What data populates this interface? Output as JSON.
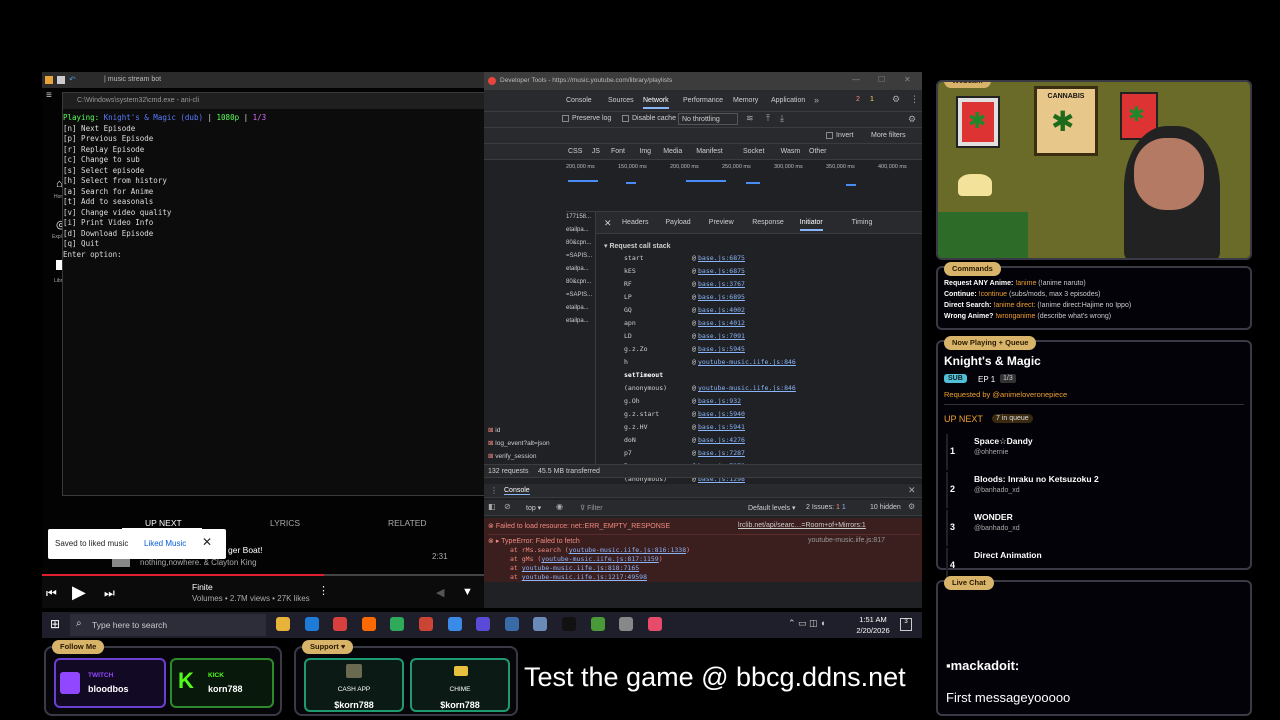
{
  "music": {
    "titlebar": "| music stream bot",
    "cmd": {
      "title": "C:\\Windows\\system32\\cmd.exe - ani-cli",
      "playing_prefix": "Playing: ",
      "playing_title": "Knight's & Magic (dub)",
      "playing_sep": " | ",
      "playing_quality": "1080p",
      "playing_ep": "1/3",
      "lines": [
        "[n] Next Episode",
        "[p] Previous Episode",
        "[r] Replay Episode",
        "[c] Change to sub",
        "[s] Select episode",
        "[h] Select from history",
        "[a] Search for Anime",
        "[t] Add to seasonals",
        "[v] Change video quality",
        "[i] Print Video Info",
        "[d] Download Episode",
        "[q] Quit",
        "Enter option:"
      ]
    },
    "side_labels": [
      "Hom",
      "Expl",
      "Libr"
    ],
    "tabs": {
      "up_next": "UP NEXT",
      "lyrics": "LYRICS",
      "related": "RELATED"
    },
    "toast": {
      "text": "Saved to liked music",
      "action": "Liked Music"
    },
    "queue_item": {
      "title_fragment": "ger Boat!",
      "artist": "nothing,nowhere. & Clayton King",
      "duration": "2:31"
    },
    "player": {
      "title": "Finite",
      "meta": "Volumes • 2.7M views • 27K likes"
    }
  },
  "devtools": {
    "title": "Developer Tools - https://music.youtube.com/library/playlists",
    "tabs": [
      "Console",
      "Sources",
      "Network",
      "Performance",
      "Memory",
      "Application"
    ],
    "errors_count": "2",
    "warn_count": "1",
    "preserve_log": "Preserve log",
    "disable_cache": "Disable cache",
    "throttling": "No throttling",
    "invert": "Invert",
    "more_filters": "More filters",
    "filter_types": [
      "CSS",
      "JS",
      "Font",
      "Img",
      "Media",
      "Manifest",
      "Socket",
      "Wasm",
      "Other"
    ],
    "timeline": [
      "200,000 ms",
      "150,000 ms",
      "200,000 ms",
      "250,000 ms",
      "300,000 ms",
      "350,000 ms",
      "400,000 ms"
    ],
    "detail_tabs": [
      "Headers",
      "Payload",
      "Preview",
      "Response",
      "Initiator",
      "Timing"
    ],
    "req_fragments": [
      "177158...",
      "etailpa...",
      "80&cpn...",
      "=SAPIS...",
      "etailpa...",
      "80&cpn...",
      "=SAPIS...",
      "etailpa...",
      "etailpa..."
    ],
    "call_stack_title": "Request call stack",
    "stack": [
      [
        "start",
        "base.js:6875"
      ],
      [
        "kES",
        "base.js:6875"
      ],
      [
        "RF",
        "base.js:3767"
      ],
      [
        "LP",
        "base.js:6895"
      ],
      [
        "GQ",
        "base.js:4002"
      ],
      [
        "apn",
        "base.js:4012"
      ],
      [
        "LD",
        "base.js:7091"
      ],
      [
        "g.z.Zo",
        "base.js:5945"
      ],
      [
        "h",
        "youtube-music.iife.js:846"
      ],
      [
        "setTimeout",
        ""
      ],
      [
        "(anonymous)",
        "youtube-music.iife.js:846"
      ],
      [
        "g.Oh",
        "base.js:932"
      ],
      [
        "g.z.start",
        "base.js:5940"
      ],
      [
        "g.z.HV",
        "base.js:5941"
      ],
      [
        "doN",
        "base.js:4276"
      ],
      [
        "p7",
        "base.js:7287"
      ],
      [
        "Bo",
        "base.js:7279"
      ],
      [
        "(anonymous)",
        "base.js:1298"
      ]
    ],
    "requests": [
      "id",
      "log_event?alt=json",
      "verify_session"
    ],
    "requests_count": "132 requests",
    "transferred": "45.5 MB transferred",
    "drawer_tab": "Console",
    "console_context": "top",
    "console_filter": "Filter",
    "default_levels": "Default levels",
    "issues": "2 Issues:",
    "issues_err": "1",
    "issues_warn": "1",
    "hidden": "10 hidden",
    "error1": "Failed to load resource: net::ERR_EMPTY_RESPONSE",
    "error1_src": "lrclib.net/api/searc…=Room+of+Mirrors:1",
    "error2": "TypeError: Failed to fetch",
    "error2_src": "youtube-music.iife.js:817",
    "trace": [
      [
        "at rMs.search (",
        "youtube-music.iife.js:816:1338",
        ")"
      ],
      [
        "at gMs (",
        "youtube-music.iife.js:817:1159",
        ")"
      ],
      [
        "at ",
        "youtube-music.iife.js:818:7165",
        ""
      ],
      [
        "at ",
        "youtube-music.iife.js:1217:49598",
        ""
      ]
    ]
  },
  "taskbar": {
    "search_placeholder": "Type here to search",
    "time": "1:51 AM",
    "date": "2/20/2026",
    "notif": "3"
  },
  "webcam": {
    "label": "Webcam",
    "poster": "CANNABIS"
  },
  "commands": {
    "label": "Commands",
    "rows": [
      {
        "label": "Request ANY Anime:",
        "cmd": "!anime",
        "desc": "(!anime naruto)"
      },
      {
        "label": "Continue:",
        "cmd": "!continue",
        "desc": "(subs/mods, max 3 episodes)"
      },
      {
        "label": "Direct Search:",
        "cmd": "!anime direct:",
        "desc": "(!anime direct:Hajime no Ippo)"
      },
      {
        "label": "Wrong Anime?",
        "cmd": "!wronganime",
        "desc": "(describe what's wrong)"
      }
    ]
  },
  "now_playing": {
    "label": "Now Playing + Queue",
    "title": "Knight's & Magic",
    "badge": "SUB",
    "ep": "EP 1",
    "ep_of": "1/3",
    "requested_prefix": "Requested by ",
    "requested_by": "@animeloveronepiece",
    "up_next": "UP NEXT",
    "queue_count": "7 in queue",
    "queue": [
      {
        "num": "1",
        "title": "Space☆Dandy",
        "user": "@ohhernie"
      },
      {
        "num": "2",
        "title": "Bloods: Inraku no Ketsuzoku 2",
        "user": "@banhado_xd"
      },
      {
        "num": "3",
        "title": "WONDER",
        "user": "@banhado_xd"
      },
      {
        "num": "4",
        "title": "Direct Animation",
        "user": ""
      }
    ]
  },
  "live_chat": {
    "label": "Live Chat",
    "user": "mackadoit:",
    "message": "First messageyooooo"
  },
  "follow": {
    "label": "Follow Me",
    "twitch_label": "TWITCH",
    "twitch_user": "bloodbos",
    "kick_label": "KICK",
    "kick_user": "korn788"
  },
  "support": {
    "label": "Support ♥",
    "cashapp_label": "CASH APP",
    "cashapp_user": "$korn788",
    "chime_label": "CHIME",
    "chime_user": "$korn788"
  },
  "banner": "Test the game @ bbcg.ddns.net",
  "colors": {
    "accent_gold": "#d8b46a",
    "twitch": "#9146ff",
    "kick": "#53fc18",
    "cashapp": "#00d64f",
    "youtube_red": "#e01e2e"
  }
}
